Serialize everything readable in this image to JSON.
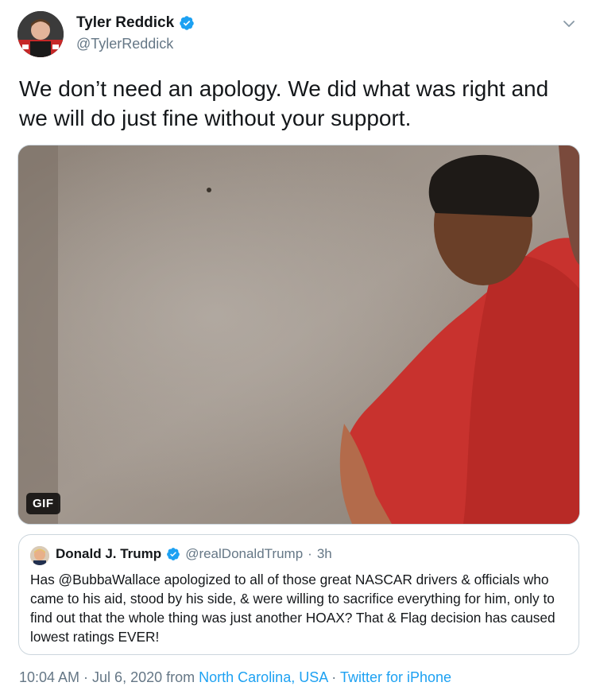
{
  "author": {
    "display_name": "Tyler Reddick",
    "handle": "@TylerReddick",
    "verified_icon": "verified-badge-icon"
  },
  "tweet": {
    "text": "We don’t need an apology. We did what was right and we will do just fine without your support.",
    "media_badge": "GIF"
  },
  "quoted_tweet": {
    "display_name": "Donald J. Trump",
    "handle": "@realDonaldTrump",
    "separator": "·",
    "time": "3h",
    "text": "Has @BubbaWallace apologized to all of those great NASCAR drivers & officials who came to his aid, stood by his side, & were willing to sacrifice everything for him, only to find out that the whole thing was just another HOAX? That & Flag decision has caused lowest ratings EVER!"
  },
  "meta": {
    "timestamp": "10:04 AM · Jul 6, 2020",
    "from_label": "from",
    "location": "North Carolina, USA",
    "separator": "·",
    "source": "Twitter for iPhone"
  },
  "colors": {
    "link": "#1da1f2",
    "muted": "#657786",
    "text": "#14171a",
    "verified": "#1da1f2"
  }
}
